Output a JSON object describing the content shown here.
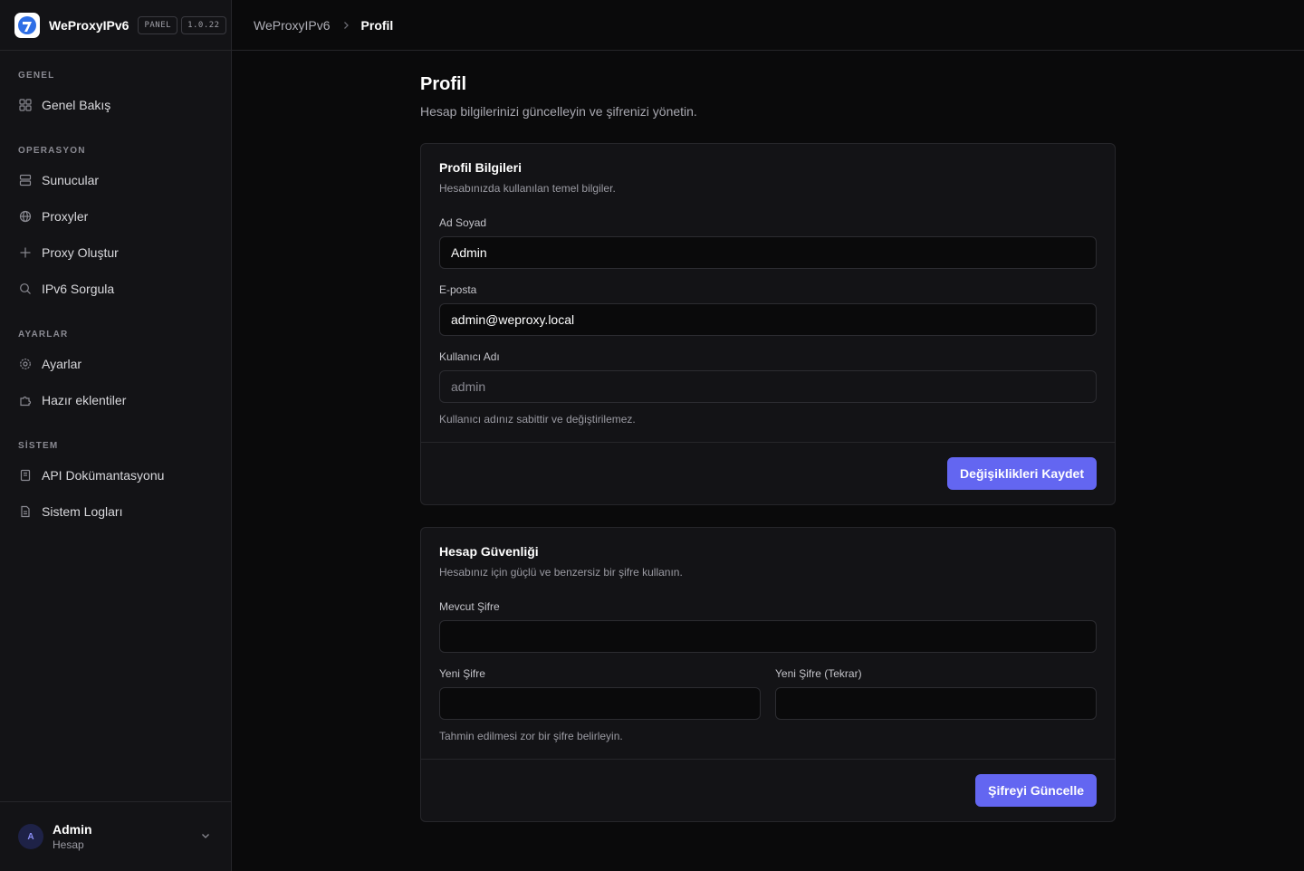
{
  "brand": {
    "name": "WeProxyIPv6",
    "badge": "PANEL",
    "version": "1.0.22"
  },
  "breadcrumb": {
    "root": "WeProxyIPv6",
    "current": "Profil"
  },
  "sidebar": {
    "sections": [
      {
        "title": "GENEL",
        "items": [
          {
            "label": "Genel Bakış",
            "icon": "grid-icon"
          }
        ]
      },
      {
        "title": "OPERASYON",
        "items": [
          {
            "label": "Sunucular",
            "icon": "server-icon"
          },
          {
            "label": "Proxyler",
            "icon": "globe-icon"
          },
          {
            "label": "Proxy Oluştur",
            "icon": "plus-icon"
          },
          {
            "label": "IPv6 Sorgula",
            "icon": "search-icon"
          }
        ]
      },
      {
        "title": "AYARLAR",
        "items": [
          {
            "label": "Ayarlar",
            "icon": "gear-icon"
          },
          {
            "label": "Hazır eklentiler",
            "icon": "puzzle-icon"
          }
        ]
      },
      {
        "title": "SİSTEM",
        "items": [
          {
            "label": "API Dokümantasyonu",
            "icon": "book-icon"
          },
          {
            "label": "Sistem Logları",
            "icon": "file-icon"
          }
        ]
      }
    ],
    "user": {
      "initial": "A",
      "name": "Admin",
      "role": "Hesap"
    }
  },
  "page": {
    "title": "Profil",
    "subtitle": "Hesap bilgilerinizi güncelleyin ve şifrenizi yönetin."
  },
  "profile_card": {
    "title": "Profil Bilgileri",
    "subtitle": "Hesabınızda kullanılan temel bilgiler.",
    "fullname_label": "Ad Soyad",
    "fullname_value": "Admin",
    "email_label": "E-posta",
    "email_value": "admin@weproxy.local",
    "username_label": "Kullanıcı Adı",
    "username_value": "admin",
    "username_hint": "Kullanıcı adınız sabittir ve değiştirilemez.",
    "save_label": "Değişiklikleri Kaydet"
  },
  "security_card": {
    "title": "Hesap Güvenliği",
    "subtitle": "Hesabınız için güçlü ve benzersiz bir şifre kullanın.",
    "current_label": "Mevcut Şifre",
    "new_label": "Yeni Şifre",
    "repeat_label": "Yeni Şifre (Tekrar)",
    "hint": "Tahmin edilmesi zor bir şifre belirleyin.",
    "update_label": "Şifreyi Güncelle"
  },
  "colors": {
    "accent": "#6366f1",
    "background": "#0a0a0b",
    "panel": "#131316",
    "border": "#26262a"
  }
}
